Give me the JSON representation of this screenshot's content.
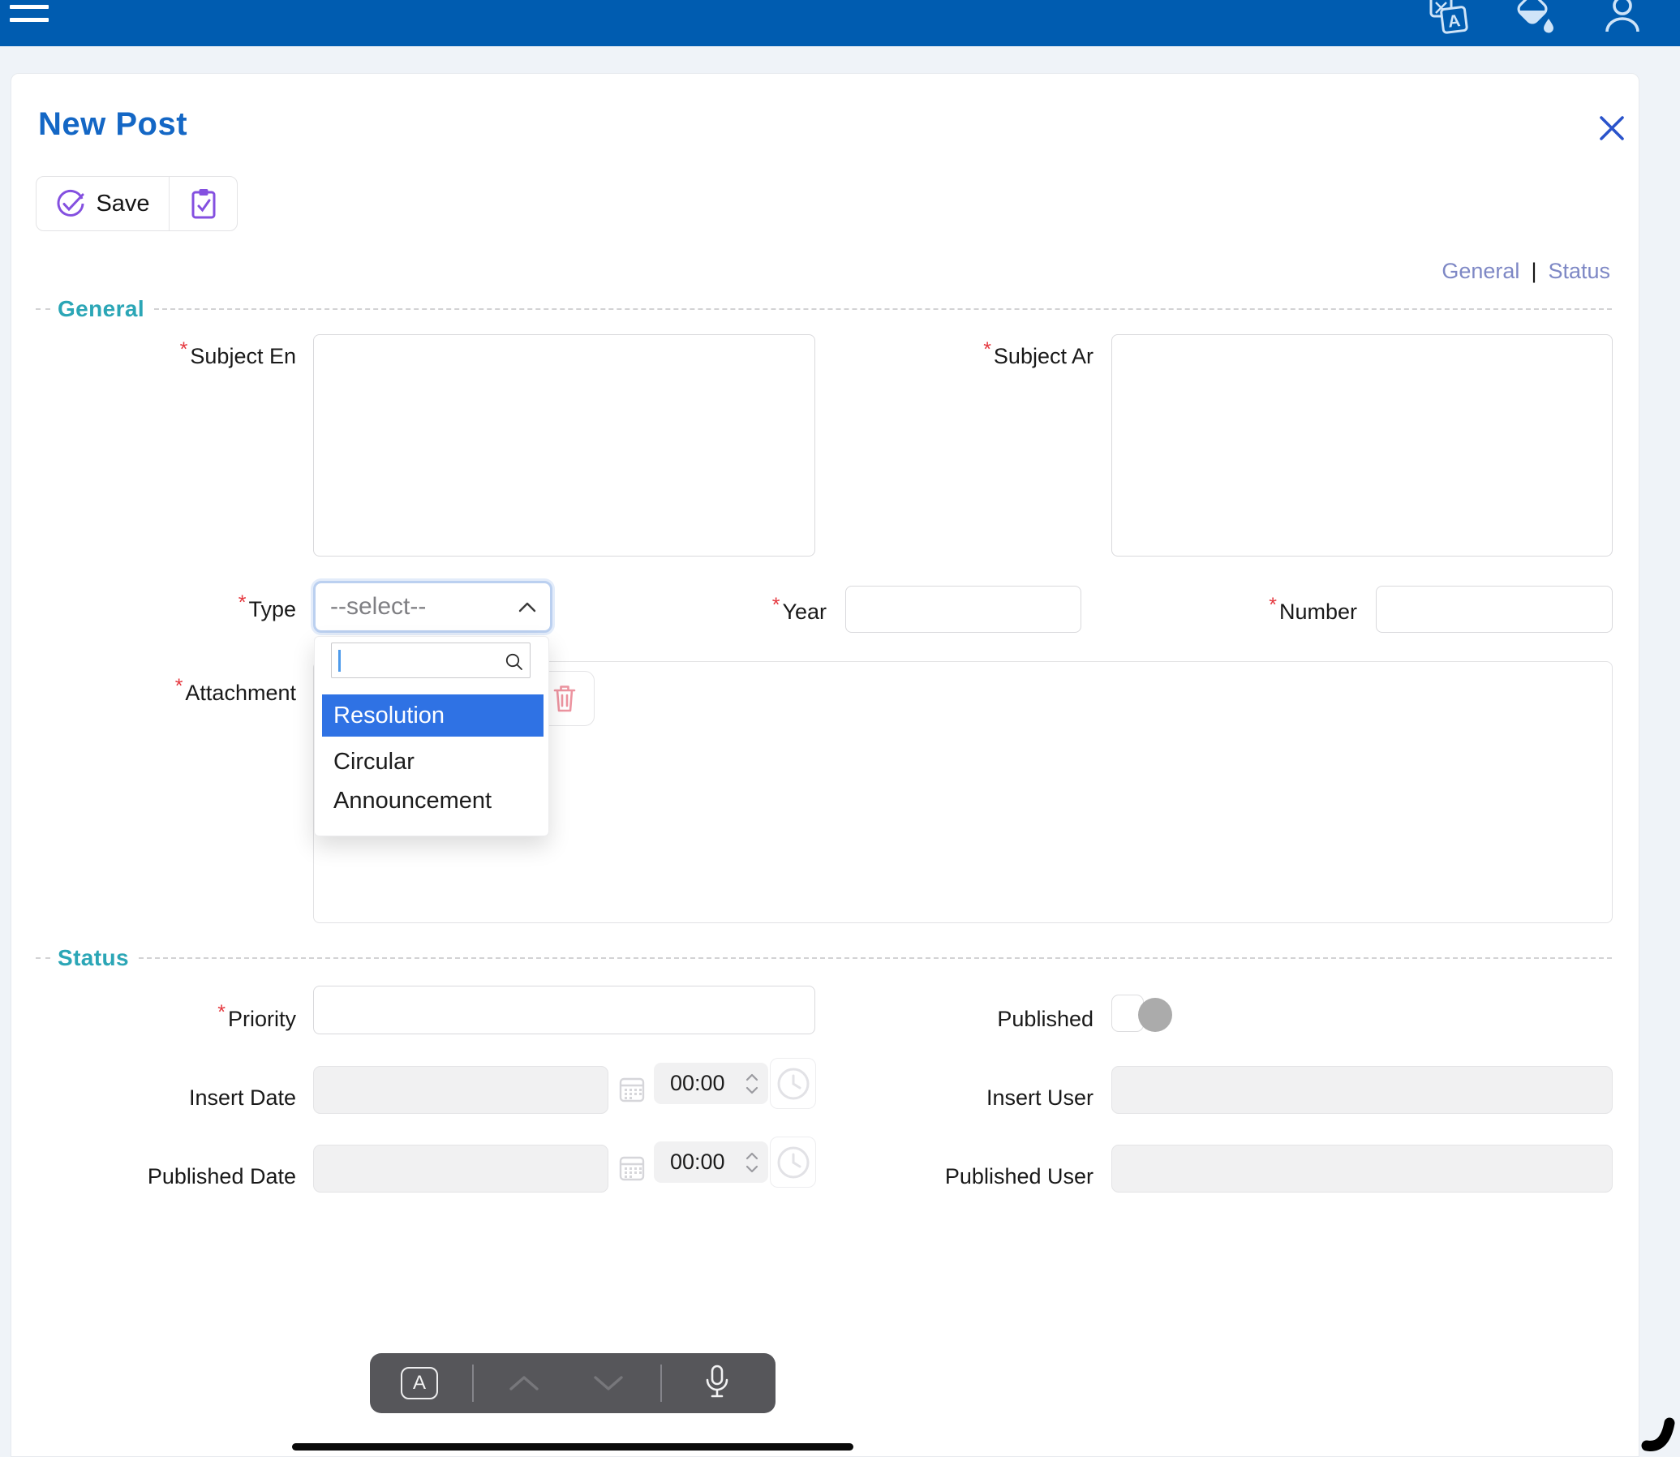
{
  "ui": {
    "required_marker": "*"
  },
  "colors": {
    "topbar_blue": "#005CB0",
    "title_blue": "#1467C5",
    "accent_teal": "#2BA6B6",
    "accent_purple": "#8450E0",
    "link_blue": "#7E88C5",
    "required_red": "#E5383F",
    "option_highlight_blue": "#2F72E4"
  },
  "topbar": {
    "icons": [
      "menu-icon",
      "translate-icon",
      "fill-color-icon",
      "user-icon"
    ]
  },
  "header": {
    "title": "New Post"
  },
  "toolbar": {
    "save_label": "Save"
  },
  "nav": {
    "general": "General",
    "separator": "|",
    "status": "Status"
  },
  "form": {
    "general": {
      "legend": "General",
      "fields": {
        "subject_en": {
          "label": "Subject En",
          "required": true,
          "value": ""
        },
        "subject_ar": {
          "label": "Subject Ar",
          "required": true,
          "value": ""
        },
        "type": {
          "label": "Type",
          "required": true,
          "placeholder": "--select--"
        },
        "year": {
          "label": "Year",
          "required": true,
          "value": ""
        },
        "number": {
          "label": "Number",
          "required": true,
          "value": ""
        },
        "attachment": {
          "label": "Attachment",
          "required": true
        }
      },
      "type_dropdown": {
        "search_value": "",
        "options": [
          {
            "label": "Resolution",
            "highlighted": true
          },
          {
            "label": "Circular",
            "highlighted": false
          },
          {
            "label": "Announcement",
            "highlighted": false
          }
        ]
      }
    },
    "status": {
      "legend": "Status",
      "fields": {
        "priority": {
          "label": "Priority",
          "required": true,
          "value": ""
        },
        "published": {
          "label": "Published",
          "toggle_on": false
        },
        "insert_date": {
          "label": "Insert Date",
          "value": "",
          "time": "00:00"
        },
        "insert_user": {
          "label": "Insert User",
          "value": ""
        },
        "published_date": {
          "label": "Published Date",
          "value": "",
          "time": "00:00"
        },
        "published_user": {
          "label": "Published User",
          "value": ""
        }
      }
    }
  },
  "keyboard_bar": {
    "format_key": "A",
    "icons": [
      "chevron-up-icon",
      "chevron-down-icon",
      "microphone-icon"
    ]
  }
}
